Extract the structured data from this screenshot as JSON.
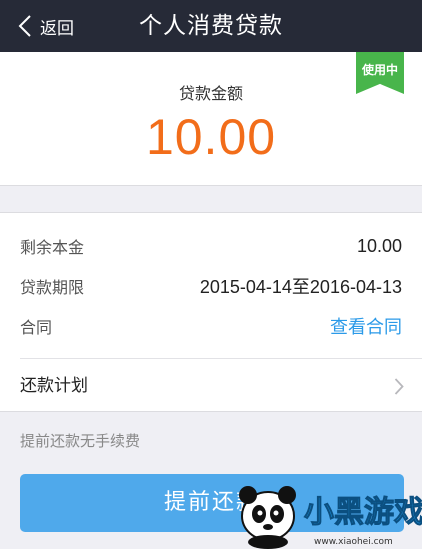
{
  "navbar": {
    "back_label": "返回",
    "title": "个人消费贷款"
  },
  "amount": {
    "label": "贷款金额",
    "value": "10.00",
    "status_ribbon": "使用中"
  },
  "details": {
    "rows": [
      {
        "label": "剩余本金",
        "value": "10.00"
      },
      {
        "label": "贷款期限",
        "value": "2015-04-14至2016-04-13"
      },
      {
        "label": "合同",
        "value": "查看合同"
      }
    ],
    "plan_label": "还款计划"
  },
  "fee_note": "提前还款无手续费",
  "prepay_button": "提前还款",
  "watermark": {
    "logo_text": "小黑游戏",
    "url": "www.xiaohei.com"
  },
  "colors": {
    "navbar": "#262a37",
    "amount": "#f26d1a",
    "ribbon": "#48b54b",
    "link": "#2b9ae8",
    "button": "#4fa9eb"
  },
  "icons": [
    "back-chevron-icon",
    "right-chevron-icon",
    "panda-logo-icon"
  ]
}
